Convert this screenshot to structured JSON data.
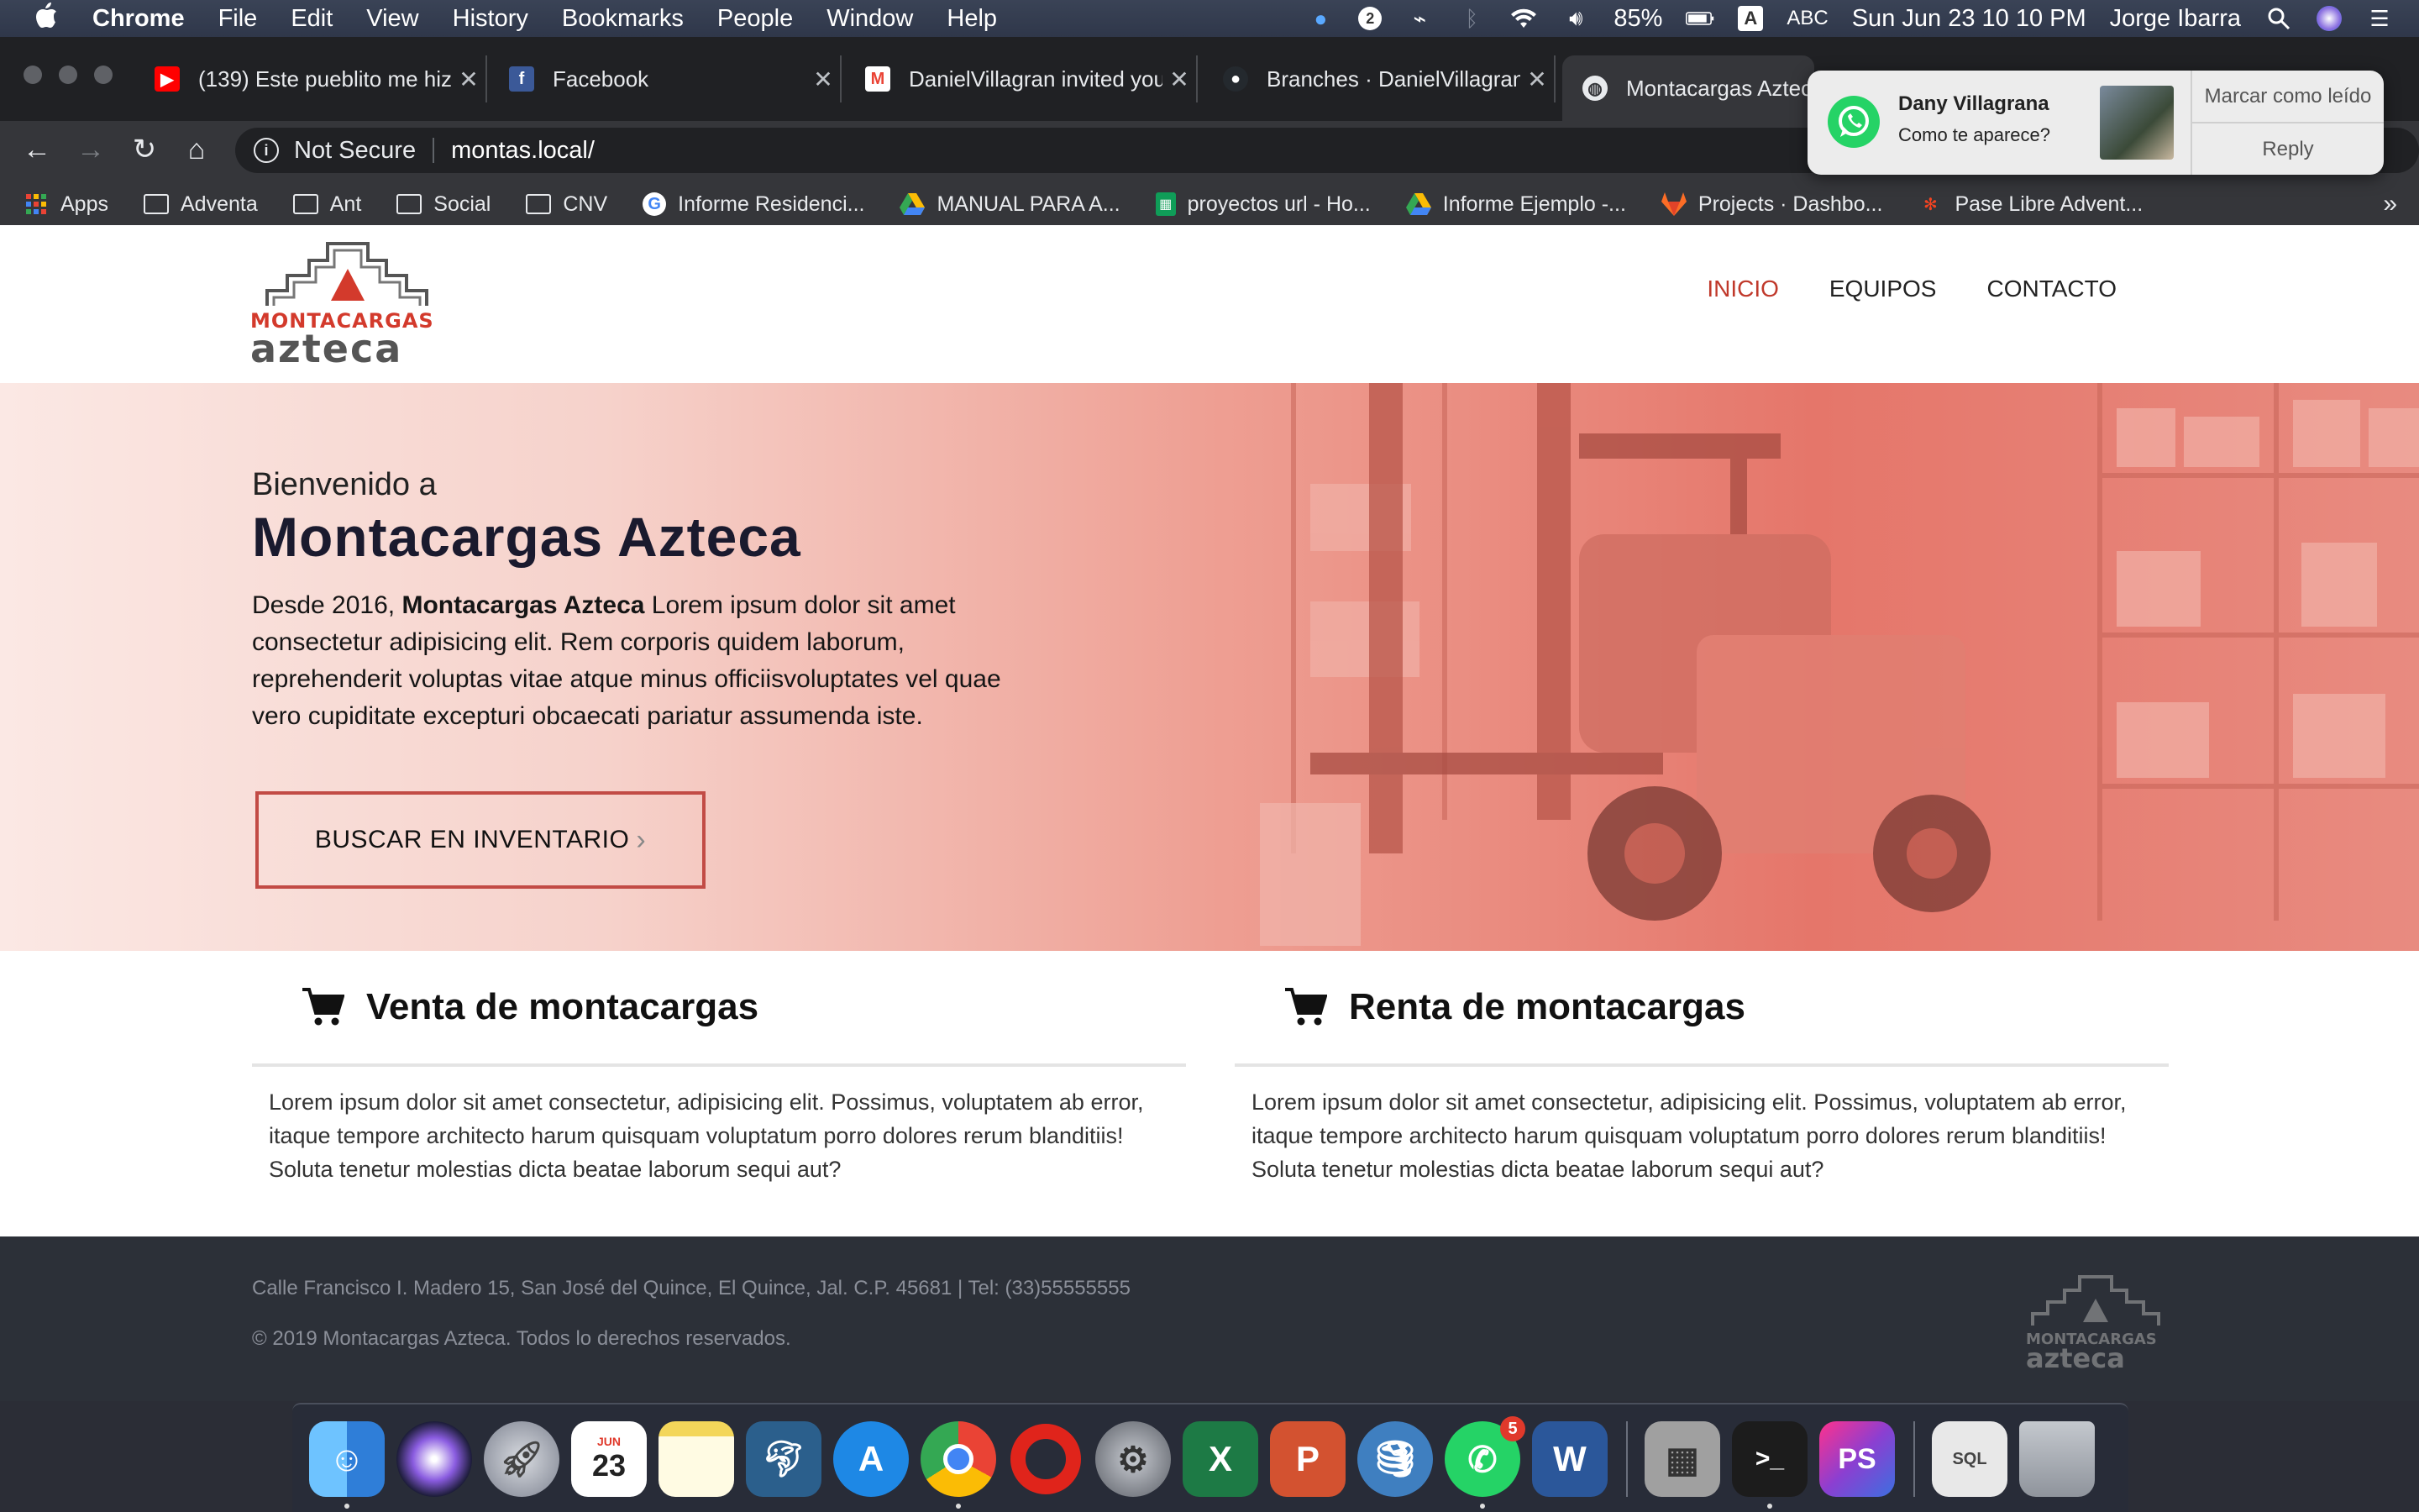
{
  "menubar": {
    "app": "Chrome",
    "items": [
      "File",
      "Edit",
      "View",
      "History",
      "Bookmarks",
      "People",
      "Window",
      "Help"
    ],
    "status": {
      "badge": "2",
      "battery": "85%",
      "input": "ABC",
      "datetime": "Sun Jun 23  10 10 PM",
      "user": "Jorge Ibarra"
    }
  },
  "tabs": [
    {
      "label": "(139) Este pueblito me hiz",
      "icon": "youtube-icon",
      "color": "#ff0000"
    },
    {
      "label": "Facebook",
      "icon": "facebook-icon",
      "color": "#3b5998"
    },
    {
      "label": "DanielVillagran invited you",
      "icon": "gmail-icon",
      "color": "#ea4335"
    },
    {
      "label": "Branches · DanielVillagran",
      "icon": "github-icon",
      "color": "#24292e"
    },
    {
      "label": "Montacargas Azteca",
      "icon": "globe-icon",
      "color": "#5f6368"
    }
  ],
  "omnibox": {
    "security": "Not Secure",
    "url": "montas.local/"
  },
  "bookmarks": [
    {
      "label": "Apps",
      "icon": "apps-grid-icon"
    },
    {
      "label": "Adventa",
      "icon": "folder-icon"
    },
    {
      "label": "Ant",
      "icon": "folder-icon"
    },
    {
      "label": "Social",
      "icon": "folder-icon"
    },
    {
      "label": "CNV",
      "icon": "folder-icon"
    },
    {
      "label": "Informe Residenci...",
      "icon": "google-icon"
    },
    {
      "label": "MANUAL PARA A...",
      "icon": "drive-icon"
    },
    {
      "label": "proyectos url - Ho...",
      "icon": "sheets-icon"
    },
    {
      "label": "Informe Ejemplo -...",
      "icon": "drive-icon"
    },
    {
      "label": "Projects · Dashbo...",
      "icon": "gitlab-icon"
    },
    {
      "label": "Pase Libre Advent...",
      "icon": "joomla-icon"
    }
  ],
  "notification": {
    "name": "Dany Villagrana",
    "message": "Como te aparece?",
    "action_primary": "Marcar como leído",
    "action_secondary": "Reply"
  },
  "site": {
    "logo_top": "MONTACARGAS",
    "logo_bottom": "azteca",
    "nav": [
      "INICIO",
      "EQUIPOS",
      "CONTACTO"
    ],
    "hero": {
      "pre": "Bienvenido a",
      "title": "Montacargas Azteca",
      "desc_prefix": "Desde 2016, ",
      "desc_bold": "Montacargas Azteca",
      "desc_rest": " Lorem ipsum dolor sit amet consectetur adipisicing elit. Rem corporis quidem laborum, reprehenderit voluptas vitae atque minus officiisvoluptates vel quae vero cupiditate excepturi obcaecati pariatur assumenda iste.",
      "button": "BUSCAR EN INVENTARIO",
      "button_chevron": "›"
    },
    "services": [
      {
        "title": "Venta de montacargas",
        "body": "Lorem ipsum dolor sit amet consectetur, adipisicing elit. Possimus, voluptatem ab error, itaque tempore architecto harum quisquam voluptatum porro dolores rerum blanditiis! Soluta tenetur molestias dicta beatae laborum sequi aut?"
      },
      {
        "title": "Renta de montacargas",
        "body": "Lorem ipsum dolor sit amet consectetur, adipisicing elit. Possimus, voluptatem ab error, itaque tempore architecto harum quisquam voluptatum porro dolores rerum blanditiis! Soluta tenetur molestias dicta beatae laborum sequi aut?"
      }
    ],
    "footer": {
      "address": "Calle Francisco I. Madero 15, San José del Quince, El Quince, Jal. C.P. 45681 | Tel: (33)55555555",
      "copyright": "© 2019 Montacargas Azteca. Todos lo derechos reservados."
    }
  },
  "dock": [
    {
      "name": "finder-icon",
      "color": "#3d8fe0"
    },
    {
      "name": "siri-icon",
      "color": "#5a3fa8"
    },
    {
      "name": "launchpad-icon",
      "color": "#8a8f99"
    },
    {
      "name": "calendar-icon",
      "color": "#f5f5f5",
      "glyph_top": "JUN",
      "glyph": "23"
    },
    {
      "name": "notes-icon",
      "color": "#f6e27a"
    },
    {
      "name": "mysql-workbench-icon",
      "color": "#2b5f8c"
    },
    {
      "name": "app-store-icon",
      "color": "#1e88e5"
    },
    {
      "name": "chrome-icon",
      "color": "#4caf50"
    },
    {
      "name": "opera-icon",
      "color": "#e0241b"
    },
    {
      "name": "system-preferences-icon",
      "color": "#6d717a"
    },
    {
      "name": "excel-icon",
      "color": "#1d7a45",
      "glyph": "X"
    },
    {
      "name": "powerpoint-icon",
      "color": "#d35230",
      "glyph": "P"
    },
    {
      "name": "sequel-pro-icon",
      "color": "#3f7fc0"
    },
    {
      "name": "whatsapp-icon",
      "color": "#25d366",
      "badge": "5"
    },
    {
      "name": "word-icon",
      "color": "#2b579a",
      "glyph": "W"
    },
    {
      "name": "calculator-icon",
      "color": "#9a9a9a"
    },
    {
      "name": "terminal-icon",
      "color": "#1c1c1c",
      "glyph": ">_"
    },
    {
      "name": "phpstorm-icon",
      "color": "#8b3fd1",
      "glyph": "PS"
    },
    {
      "name": "sql-file-icon",
      "color": "#e8e8e8",
      "glyph": "SQL"
    },
    {
      "name": "trash-icon",
      "color": "#9aa0a8"
    }
  ]
}
